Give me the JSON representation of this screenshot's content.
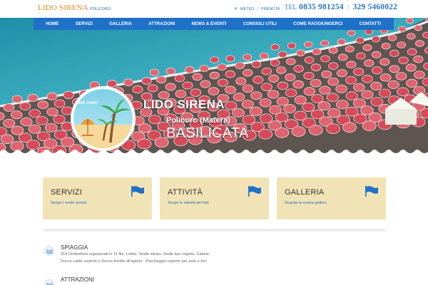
{
  "header": {
    "logo_main": "LIDO SIRENA",
    "logo_sub": "POLICORO",
    "meteo_label": "METEO",
    "prenota_label": "PRENOTA",
    "phone_label": "TEL",
    "phone_1": "0835 981254",
    "phone_sep": "/",
    "phone_2": "329 5460022"
  },
  "nav": {
    "items": [
      {
        "label": "HOME"
      },
      {
        "label": "SERVIZI"
      },
      {
        "label": "GALLERIA"
      },
      {
        "label": "ATTRAZIONI"
      },
      {
        "label": "NEWS & EVENTI"
      },
      {
        "label": "CONSIGLI UTILI"
      },
      {
        "label": "COME RAGGIUNGERCI"
      },
      {
        "label": "CONTATTI"
      }
    ]
  },
  "hero": {
    "badge_text": "MAR JONIO",
    "title": "LIDO SIRENA",
    "subtitle": "Policoro (Matera)",
    "region": "BASILICATA"
  },
  "cards": [
    {
      "title": "SERVIZI",
      "desc": "Scopri i nostri servizi",
      "icon": "flag-icon"
    },
    {
      "title": "ATTIVITÀ",
      "desc": "Scopri le attività del lido",
      "icon": "flag-icon"
    },
    {
      "title": "GALLERIA",
      "desc": "Guarda la nostra gallery",
      "icon": "flag-icon"
    }
  ],
  "info": [
    {
      "title": "SPIAGGIA",
      "icon": "waves-icon",
      "text": "314 Ombrelloni organizzati in 11 file, Lettini, Sedie sdraio, Sedie tipo regista, Cabine, Docce calde coperte e Docce fredde all'aperto - Parcheggio coperto per auto e bici"
    },
    {
      "title": "ATTRAZIONI",
      "icon": "waves-icon",
      "text": ""
    }
  ],
  "colors": {
    "brand_blue": "#1f71c7",
    "logo_orange": "#e58a1f",
    "card_bg": "#f2e3b6",
    "umbrella_red": "#d64a5a"
  }
}
